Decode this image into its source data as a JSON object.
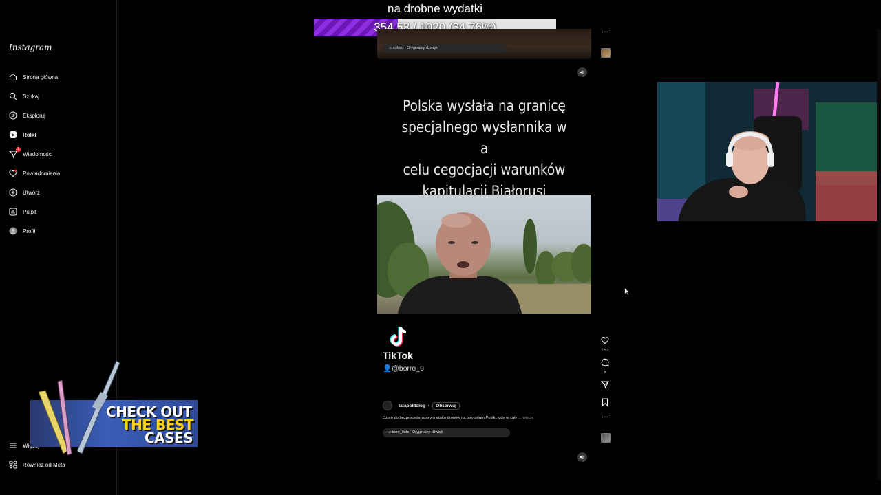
{
  "sidebar": {
    "logo": "Instagram",
    "items": [
      {
        "label": "Strona główna",
        "icon": "home-icon"
      },
      {
        "label": "Szukaj",
        "icon": "search-icon"
      },
      {
        "label": "Eksploruj",
        "icon": "compass-icon"
      },
      {
        "label": "Rolki",
        "icon": "reels-icon",
        "active": true
      },
      {
        "label": "Wiadomości",
        "icon": "messages-icon",
        "badge": "1"
      },
      {
        "label": "Powiadomienia",
        "icon": "heart-icon"
      },
      {
        "label": "Utwórz",
        "icon": "plus-square-icon"
      },
      {
        "label": "Pulpit",
        "icon": "dashboard-icon"
      },
      {
        "label": "Profil",
        "icon": "profile-avatar"
      }
    ],
    "bottom": [
      {
        "label": "Więcej",
        "icon": "menu-icon"
      },
      {
        "label": "Również od Meta",
        "icon": "meta-icon"
      }
    ]
  },
  "stream_goal": {
    "title": "na drobne wydatki",
    "progress_text": "354.58 / 1020 (34.76%)",
    "fraction": 0.3476,
    "fill_color": "#8e2ee0"
  },
  "reel_prev": {
    "audio": "mikslu - Oryginalny dźwięk"
  },
  "reel": {
    "caption_lines": [
      "Polska wysłała na granicę",
      "specjalnego wysłannika w a",
      "celu cegocjacji warunków",
      "kapitulacji Białorusi"
    ],
    "watermark_name": "TikTok",
    "watermark_user": "@borro_9",
    "author": "tatapolitolog",
    "follow_label": "Obserwuj",
    "description": "Dzień po bezprecedensowym ataku dronów na terytorium Polski, gdy w cały ...",
    "more_label": "więcej",
    "audio": "boro_9ofc - Oryginalny dźwięk",
    "likes": "2252",
    "comments": "8"
  },
  "ad": {
    "line1": "CHECK OUT",
    "line2": "THE BEST",
    "line3": "CASES",
    "accent": "#ffd21a"
  }
}
